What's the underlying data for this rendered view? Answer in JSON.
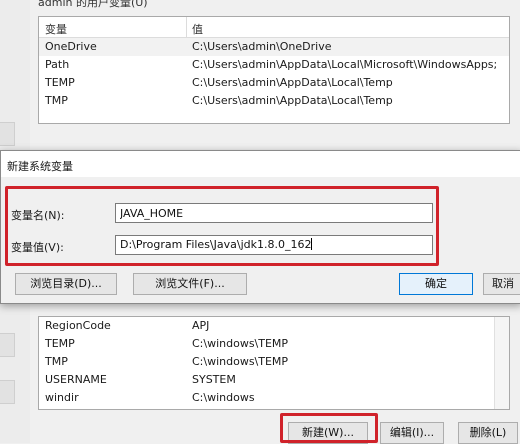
{
  "background_window": {
    "group_title": "admin 的用户变量(U)",
    "columns": [
      "变量",
      "值"
    ],
    "user_vars": [
      {
        "name": "OneDrive",
        "value": "C:\\Users\\admin\\OneDrive"
      },
      {
        "name": "Path",
        "value": "C:\\Users\\admin\\AppData\\Local\\Microsoft\\WindowsApps;"
      },
      {
        "name": "TEMP",
        "value": "C:\\Users\\admin\\AppData\\Local\\Temp"
      },
      {
        "name": "TMP",
        "value": "C:\\Users\\admin\\AppData\\Local\\Temp"
      }
    ],
    "system_vars": [
      {
        "name": "RegionCode",
        "value": "APJ"
      },
      {
        "name": "TEMP",
        "value": "C:\\windows\\TEMP"
      },
      {
        "name": "TMP",
        "value": "C:\\windows\\TEMP"
      },
      {
        "name": "USERNAME",
        "value": "SYSTEM"
      },
      {
        "name": "windir",
        "value": "C:\\windows"
      }
    ],
    "buttons": {
      "new": "新建(W)...",
      "edit": "编辑(I)...",
      "delete": "删除(L)"
    }
  },
  "dialog": {
    "title": "新建系统变量",
    "name_label": "变量名(N):",
    "name_value": "JAVA_HOME",
    "value_label": "变量值(V):",
    "value_value": "D:\\Program Files\\Java\\jdk1.8.0_162",
    "browse_dir": "浏览目录(D)...",
    "browse_file": "浏览文件(F)...",
    "ok": "确定",
    "cancel": "取消"
  },
  "colors": {
    "highlight": "#d0222a",
    "default_button_border": "#0078d7"
  }
}
